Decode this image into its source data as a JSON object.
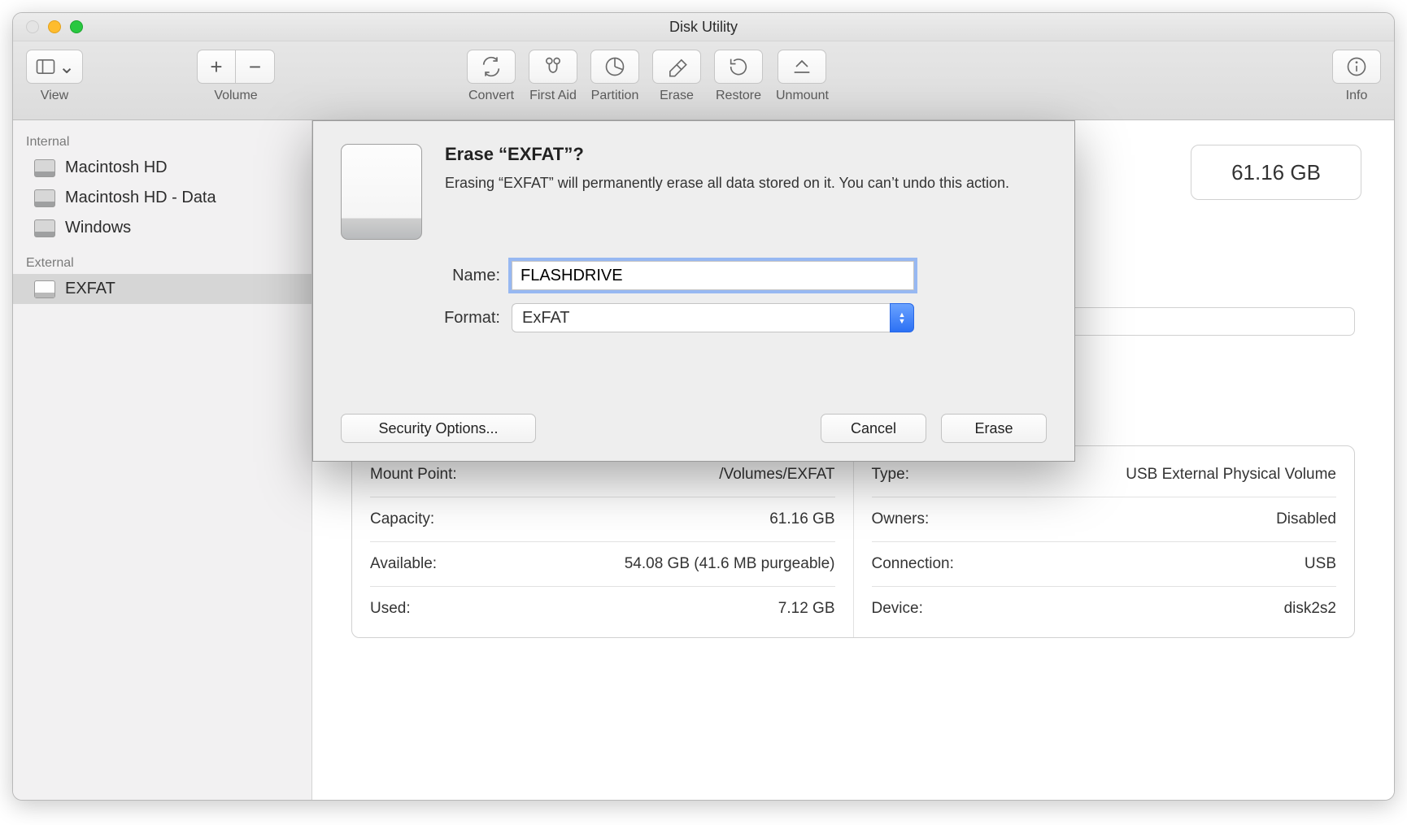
{
  "window": {
    "title": "Disk Utility"
  },
  "toolbar": {
    "view": "View",
    "volume": "Volume",
    "convert": "Convert",
    "firstaid": "First Aid",
    "partition": "Partition",
    "erase": "Erase",
    "restore": "Restore",
    "unmount": "Unmount",
    "info": "Info"
  },
  "sidebar": {
    "internal_label": "Internal",
    "external_label": "External",
    "internal": [
      {
        "name": "Macintosh HD"
      },
      {
        "name": "Macintosh HD - Data"
      },
      {
        "name": "Windows"
      }
    ],
    "external": [
      {
        "name": "EXFAT"
      }
    ]
  },
  "main": {
    "capacity_chip": "61.16 GB",
    "left": {
      "mount_point_label": "Mount Point:",
      "mount_point_value": "/Volumes/EXFAT",
      "capacity_label": "Capacity:",
      "capacity_value": "61.16 GB",
      "available_label": "Available:",
      "available_value": "54.08 GB (41.6 MB purgeable)",
      "used_label": "Used:",
      "used_value": "7.12 GB"
    },
    "right": {
      "type_label": "Type:",
      "type_value": "USB External Physical Volume",
      "owners_label": "Owners:",
      "owners_value": "Disabled",
      "connection_label": "Connection:",
      "connection_value": "USB",
      "device_label": "Device:",
      "device_value": "disk2s2"
    }
  },
  "dialog": {
    "title": "Erase “EXFAT”?",
    "desc": "Erasing “EXFAT” will permanently erase all data stored on it. You can’t undo this action.",
    "name_label": "Name:",
    "name_value": "FLASHDRIVE",
    "format_label": "Format:",
    "format_value": "ExFAT",
    "security": "Security Options...",
    "cancel": "Cancel",
    "erase": "Erase"
  }
}
